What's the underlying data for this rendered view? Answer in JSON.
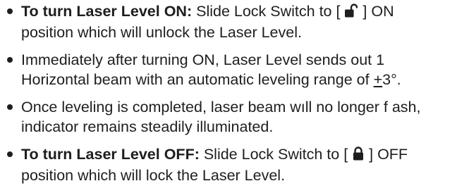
{
  "items": [
    {
      "lines": [
        {
          "bold": "To turn Laser Level ON:",
          "pre": " Slide Lock Switch to [ ",
          "icon": "unlocked-padlock-icon",
          "post": " ] ON"
        },
        {
          "text": "position which will unlock the Laser Level."
        }
      ]
    },
    {
      "lines": [
        {
          "text": "Immediately after turning ON, Laser Level sends out 1"
        },
        {
          "pre": "Horizontal beam with an automatic leveling range of ",
          "pm": "+",
          "post": "3°."
        }
      ]
    },
    {
      "lines": [
        {
          "text": "Once leveling is completed, laser beam wıll no longer f ash,"
        },
        {
          "text": "indicator remains steadily illuminated."
        }
      ]
    },
    {
      "lines": [
        {
          "bold": "To turn Laser Level OFF:",
          "pre": " Slide Lock Switch to [ ",
          "icon": "locked-padlock-icon",
          "post": " ] OFF"
        },
        {
          "text": "position which will lock the Laser Level."
        }
      ]
    }
  ]
}
